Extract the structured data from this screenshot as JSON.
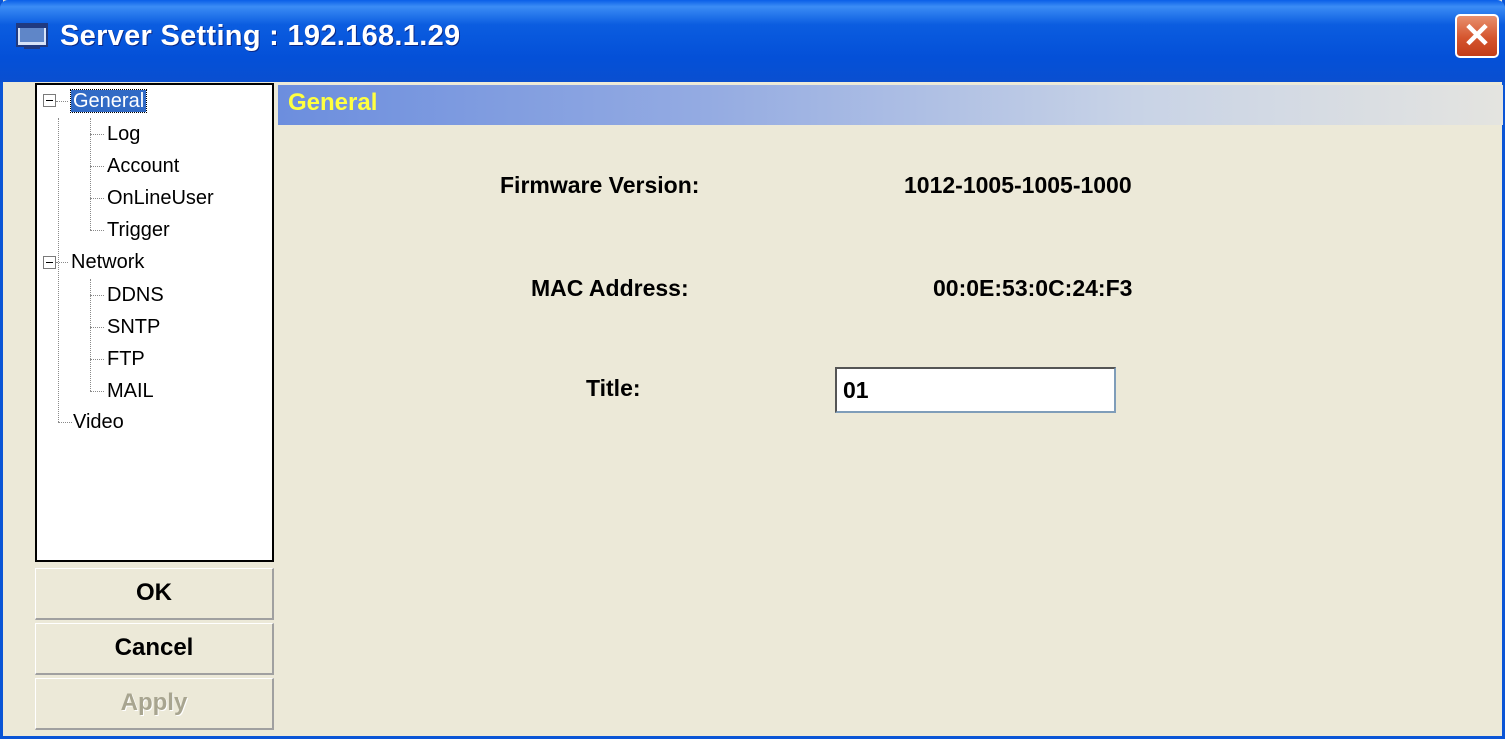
{
  "window": {
    "title": "Server Setting : 192.168.1.29",
    "close_label": "✕"
  },
  "tree": {
    "items": [
      {
        "label": "General",
        "selected": true
      },
      {
        "label": "Log"
      },
      {
        "label": "Account"
      },
      {
        "label": "OnLineUser"
      },
      {
        "label": "Trigger"
      },
      {
        "label": "Network"
      },
      {
        "label": "DDNS"
      },
      {
        "label": "SNTP"
      },
      {
        "label": "FTP"
      },
      {
        "label": "MAIL"
      },
      {
        "label": "Video"
      }
    ]
  },
  "buttons": {
    "ok": "OK",
    "cancel": "Cancel",
    "apply": "Apply"
  },
  "section": {
    "header": "General"
  },
  "fields": {
    "firmware_label": "Firmware Version:",
    "firmware_value": "1012-1005-1005-1000",
    "mac_label": "MAC Address:",
    "mac_value": "00:0E:53:0C:24:F3",
    "title_label": "Title:",
    "title_value": "01"
  }
}
